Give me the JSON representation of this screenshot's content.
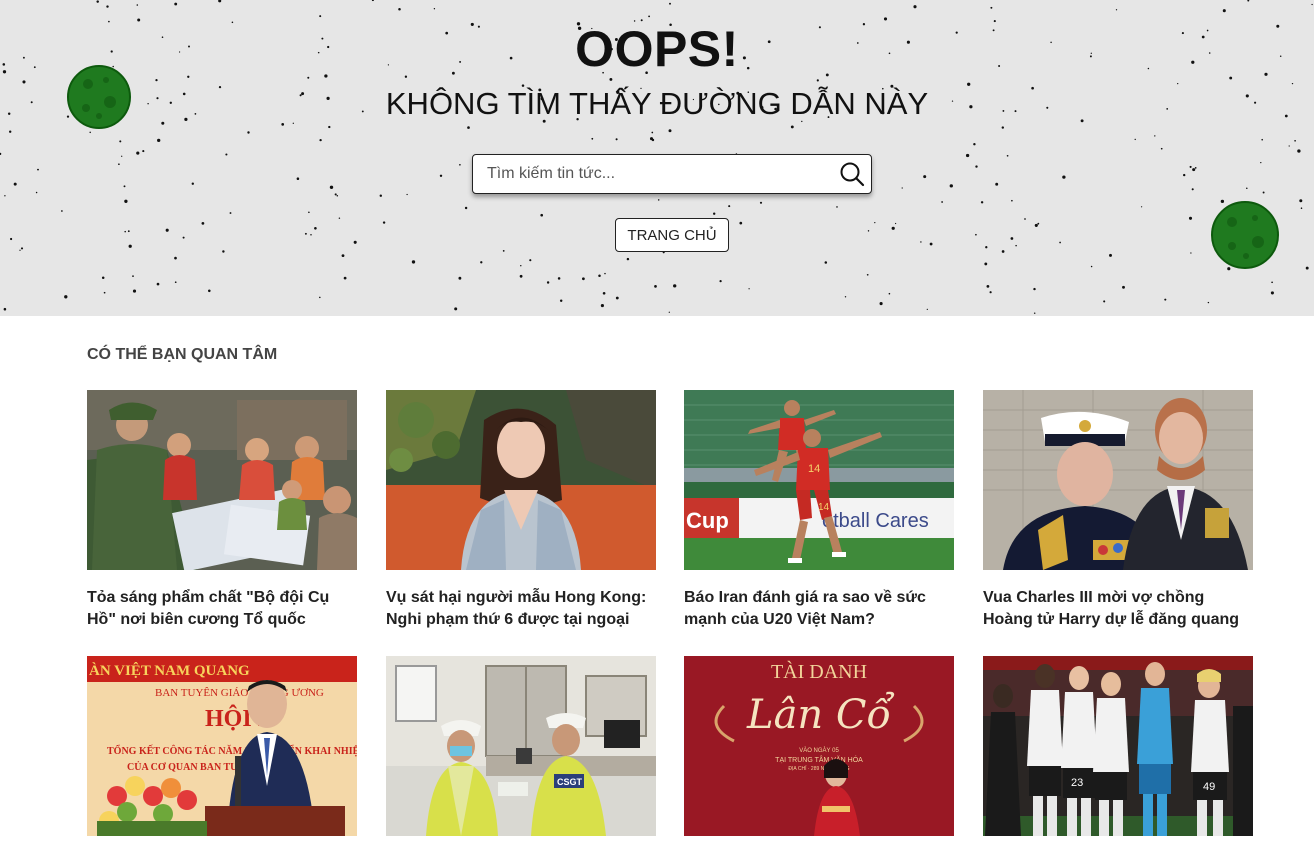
{
  "hero": {
    "title": "OOPS!",
    "subtitle": "KHÔNG TÌM THẤY ĐƯỜNG DẪN NÀY",
    "search_placeholder": "Tìm kiếm tin tức...",
    "home_label": "TRANG CHỦ"
  },
  "section": {
    "title": "CÓ THỂ BẠN QUAN TÂM"
  },
  "articles": [
    {
      "title": "Tỏa sáng phẩm chất \"Bộ đội Cụ Hồ\" nơi biên cương Tổ quốc"
    },
    {
      "title": "Vụ sát hại người mẫu Hong Kong: Nghi phạm thứ 6 được tại ngoại"
    },
    {
      "title": "Báo Iran đánh giá ra sao về sức mạnh của U20 Việt Nam?"
    },
    {
      "title": "Vua Charles III mời vợ chồng Hoàng tử Harry dự lễ đăng quang"
    },
    {
      "title": ""
    },
    {
      "title": ""
    },
    {
      "title": ""
    },
    {
      "title": ""
    }
  ],
  "image_text": {
    "football_banner_left": "Cup",
    "football_banner_right": "otball Cares",
    "football_shirt_number_a": "14",
    "football_shirt_number_b": "14",
    "conference_banner_top": "ÀN VIỆT NAM QUANG",
    "conference_org": "BAN TUYÊN GIÁO TRUNG ƯƠNG",
    "conference_headline": "HỘI N",
    "conference_line1": "TỔNG KẾT CÔNG TÁC NĂM 2022; TRIỂN KHAI NHIỆM V",
    "conference_line2": "CỦA CƠ QUAN BAN TUYÊN GIÁO",
    "police_vest_label": "CSGT",
    "music_poster_top": "TÀI DANH",
    "music_poster_script": "Lân Cổ",
    "music_poster_date": "VÀO NGÀY 05",
    "music_poster_venue": "TẠI TRUNG TÂM VĂN HÓA",
    "music_poster_address": "ĐỊA CHỈ · 289 NGÔ GIANG",
    "mu_player_numbers": [
      "23",
      "49"
    ]
  },
  "colors": {
    "hero_bg": "#e6e6e6",
    "planet": "#1f7a1f",
    "text_dark": "#111111"
  }
}
